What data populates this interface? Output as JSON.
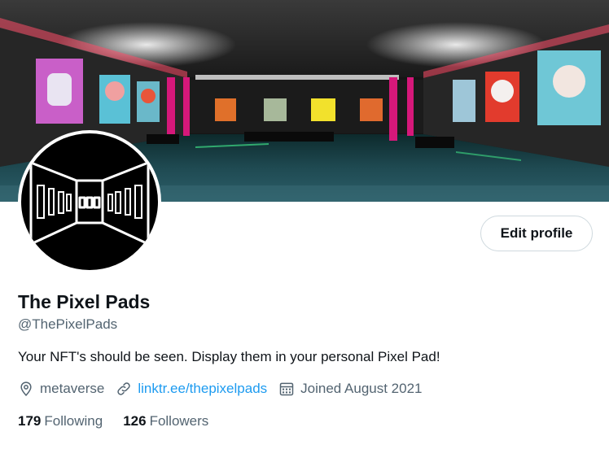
{
  "profile": {
    "name": "The Pixel Pads",
    "handle": "@ThePixelPads",
    "bio": "Your NFT's should be seen. Display them in your personal Pixel Pad!",
    "location": "metaverse",
    "website": "linktr.ee/thepixelpads",
    "joined": "Joined August 2021",
    "following_count": "179",
    "following_label": "Following",
    "followers_count": "126",
    "followers_label": "Followers"
  },
  "actions": {
    "edit_profile_label": "Edit profile"
  },
  "icons": {
    "location": "location-pin-icon",
    "link": "link-icon",
    "calendar": "calendar-icon"
  },
  "colors": {
    "link": "#1d9bf0",
    "secondary_text": "#536471",
    "primary_text": "#0f1419"
  }
}
